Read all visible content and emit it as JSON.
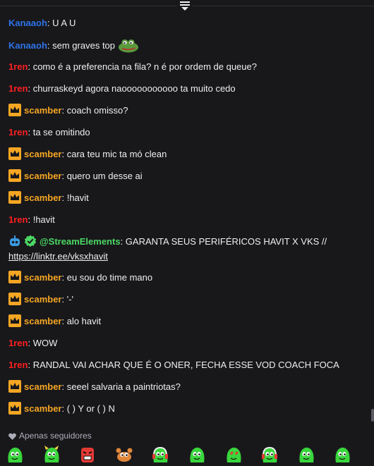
{
  "chat": {
    "messages": [
      {
        "user": "Kanaaoh",
        "color": "#2e73e6",
        "badge": "none",
        "text": "U A U"
      },
      {
        "user": "Kanaaoh",
        "color": "#2e73e6",
        "badge": "none",
        "text": "sem graves top",
        "emote": "pepe-frog-emote"
      },
      {
        "user": "1ren",
        "color": "#ff1f1f",
        "badge": "none",
        "text": "como é a preferencia na fila? n é por ordem de queue?"
      },
      {
        "user": "1ren",
        "color": "#ff1f1f",
        "badge": "none",
        "text": "churraskeyd agora naooooooooooo ta muito cedo"
      },
      {
        "user": "scamber",
        "color": "#f5a623",
        "badge": "crown",
        "text": "coach omisso?"
      },
      {
        "user": "1ren",
        "color": "#ff1f1f",
        "badge": "none",
        "text": "ta se omitindo"
      },
      {
        "user": "scamber",
        "color": "#f5a623",
        "badge": "crown",
        "text": "cara teu mic ta mó clean"
      },
      {
        "user": "scamber",
        "color": "#f5a623",
        "badge": "crown",
        "text": "quero um desse ai"
      },
      {
        "user": "scamber",
        "color": "#f5a623",
        "badge": "crown",
        "text": "!havit"
      },
      {
        "user": "1ren",
        "color": "#ff1f1f",
        "badge": "none",
        "text": "!havit"
      },
      {
        "user": "@StreamElements",
        "color": "#4cd964",
        "badge": "bot-verified",
        "text": "GARANTA SEUS PERIFÉRICOS HAVIT X VKS //",
        "link": "https://linktr.ee/vksxhavit"
      },
      {
        "user": "scamber",
        "color": "#f5a623",
        "badge": "crown",
        "text": "eu sou do time mano"
      },
      {
        "user": "scamber",
        "color": "#f5a623",
        "badge": "crown",
        "text": "'-'"
      },
      {
        "user": "scamber",
        "color": "#f5a623",
        "badge": "crown",
        "text": "alo havit"
      },
      {
        "user": "1ren",
        "color": "#ff1f1f",
        "badge": "none",
        "text": "WOW"
      },
      {
        "user": "1ren",
        "color": "#ff1f1f",
        "badge": "none",
        "text": "RANDAL VAI ACHAR QUE É O ONER, FECHA ESSE VOD COACH FOCA"
      },
      {
        "user": "scamber",
        "color": "#f5a623",
        "badge": "crown",
        "text": "seeel salvaria a paintriotas?"
      },
      {
        "user": "scamber",
        "color": "#f5a623",
        "badge": "crown",
        "text": "( ) Y or ( ) N"
      }
    ]
  },
  "footer": {
    "followers_only": "Apenas seguidores",
    "emotes": [
      "green-blob-emote",
      "green-horned-emote",
      "red-angry-emote",
      "crab-emote",
      "headset-blob-emote",
      "green-blob-side-emote",
      "green-blob-heart-eyes-emote",
      "headset-blob-2-emote",
      "green-blob-3-emote",
      "green-blob-smile-emote"
    ]
  }
}
